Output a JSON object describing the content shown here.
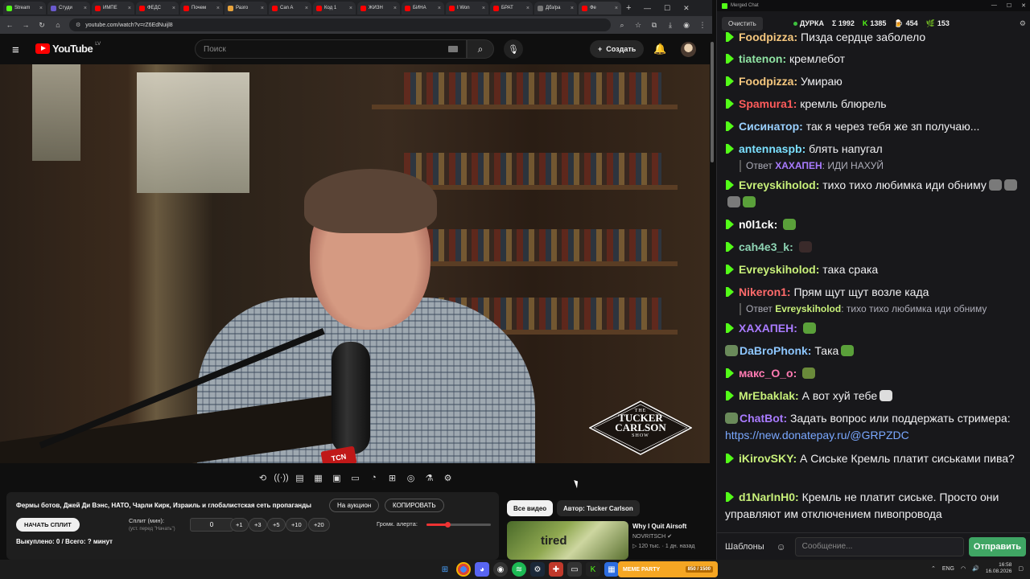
{
  "browser": {
    "tabs": [
      {
        "label": "Stream",
        "color": "#53fc18"
      },
      {
        "label": "Студи",
        "color": "#6a5acd"
      },
      {
        "label": "ИМПЕ",
        "color": "#ff0000"
      },
      {
        "label": "ФЕДС",
        "color": "#ff0000"
      },
      {
        "label": "Почем",
        "color": "#ff0000"
      },
      {
        "label": "Разго",
        "color": "#e8a33b"
      },
      {
        "label": "Can A",
        "color": "#ff0000"
      },
      {
        "label": "Код 1",
        "color": "#ff0000"
      },
      {
        "label": "ЖИЗН",
        "color": "#ff0000"
      },
      {
        "label": "БИНА",
        "color": "#ff0000"
      },
      {
        "label": "I Won",
        "color": "#ff0000"
      },
      {
        "label": "БРАТ",
        "color": "#ff0000"
      },
      {
        "label": "Дбз/ра",
        "color": "#777777"
      },
      {
        "label": "Фе",
        "color": "#ff0000",
        "active": true
      }
    ],
    "url": "youtube.com/watch?v=rZ6EdNuijl8",
    "new_tab_symbol": "+"
  },
  "youtube": {
    "logo_text": "YouTube",
    "country_code": "LV",
    "search_placeholder": "Поиск",
    "create_label": "Создать",
    "brand_color": "#ff0000"
  },
  "video": {
    "badge": {
      "the": "THE",
      "line1": "TUCKER",
      "line2": "CARLSON",
      "show": "SHOW"
    },
    "mic_flag": "TCN"
  },
  "extension_toolbar": {
    "icons": [
      "loop-icon",
      "broadcast-icon",
      "stats-icon",
      "clapper-icon",
      "picture-icon",
      "theater-icon",
      "speed-icon",
      "screenshot-icon",
      "camera-icon",
      "flask-icon",
      "settings-icon"
    ]
  },
  "split_panel": {
    "title": "Фермы ботов, Джей Ди Вэнс, НАТО, Чарли Кирк, Израиль и глобалистская сеть пропаганды",
    "auction_label": "На аукцион",
    "copy_label": "КОПИРОВАТЬ",
    "start_label": "НАЧАТЬ СПЛИТ",
    "split_label": "Сплит (мин):",
    "split_hint": "(уст. перед \"Начать\")",
    "split_value": "0",
    "increments": [
      "+1",
      "+3",
      "+5",
      "+10",
      "+20"
    ],
    "volume_label": "Громк. алерта:",
    "volume_level": 0.32,
    "bought_text": "Выкуплено: 0 / Всего: ? минут"
  },
  "recommendations": {
    "chip_all": "Все видео",
    "chip_author": "Автор: Tucker Carlson",
    "item": {
      "thumb_text": "tired",
      "title": "Why I Quit Airsoft",
      "channel": "NOVRITSCH",
      "meta": "120 тыс. · 1 дн. назад"
    }
  },
  "chat": {
    "window_title": "Merged Chat",
    "clear_label": "Очистить",
    "streamer": "ДУРКА",
    "stats": {
      "sigma": "Σ 1992",
      "kick": "1385",
      "yt": "454",
      "other": "153"
    },
    "messages": [
      {
        "nick": "Foodpizza",
        "color": "#f5c77e",
        "text": "Пизда сердце заболело",
        "badge": true
      },
      {
        "nick": "tiatenon",
        "color": "#8fe3a3",
        "text": "кремлебот",
        "badge": true
      },
      {
        "nick": "Foodpizza",
        "color": "#f5c77e",
        "text": "Умираю",
        "badge": true
      },
      {
        "nick": "Spamura1",
        "color": "#ff5b5b",
        "text": "кремль блюрель",
        "badge": true
      },
      {
        "nick": "Сисинатор",
        "color": "#9ad0ff",
        "text": "так я через тебя же зп получаю...",
        "badge": true
      },
      {
        "nick": "antennaspb",
        "color": "#7be0ff",
        "text": "блять напугал",
        "badge": true
      },
      {
        "nick": "Evreyskiholod",
        "color": "#c8f07a",
        "text": "тихо тихо любимка иди обниму",
        "badge": true
      },
      {
        "nick": "n0l1ck",
        "color": "#ffffff",
        "text": "",
        "badge": true
      },
      {
        "nick": "cah4e3_k",
        "color": "#8fd5b5",
        "text": "",
        "badge": true
      },
      {
        "nick": "Evreyskiholod",
        "color": "#c8f07a",
        "text": "така срака",
        "badge": true
      },
      {
        "nick": "Nikeron1",
        "color": "#ff6b6b",
        "text": "Прям щут щут возле када",
        "badge": true
      },
      {
        "nick": "ХАХАПЕН",
        "color": "#a97bff",
        "text": "",
        "badge": true
      },
      {
        "nick": "DaBroPhonk",
        "color": "#8ec7ff",
        "text": "Така",
        "badge": false
      },
      {
        "nick": "макс_О_о",
        "color": "#ff7ab2",
        "text": "",
        "badge": true
      },
      {
        "nick": "MrEbaklak",
        "color": "#c8f07a",
        "text": "А вот хуй тебе",
        "badge": true
      },
      {
        "nick": "ChatBot",
        "color": "#a97bff",
        "text": "Задать вопрос или поддержать стримера: ",
        "link": "https://new.donatepay.ru/@GRPZDC",
        "badge": false
      },
      {
        "nick": "iKirovSKY",
        "color": "#c8f07a",
        "text": "А Сиське Кремль платит сиськами пива?",
        "badge": true
      },
      {
        "nick": "d1NarInH0",
        "color": "#c8f07a",
        "text": "Кремль не платит сиське. Просто они управляют им отключением пивопровода",
        "badge": true
      }
    ],
    "replies": [
      {
        "label": "Ответ",
        "nick": "ХАХАПЕН",
        "text": "ИДИ НАХУЙ"
      },
      {
        "label": "Ответ",
        "nick": "Evreyskiholod",
        "text": "тихо тихо любимка иди обниму"
      }
    ],
    "templates_label": "Шаблоны",
    "input_placeholder": "Сообщение...",
    "send_label": "Отправить"
  },
  "taskbar": {
    "widget_label": "MEME PARTY",
    "widget_progress": "850 / 1500",
    "lang": "ENG",
    "time": "16:58",
    "date": "16.08.2026"
  }
}
